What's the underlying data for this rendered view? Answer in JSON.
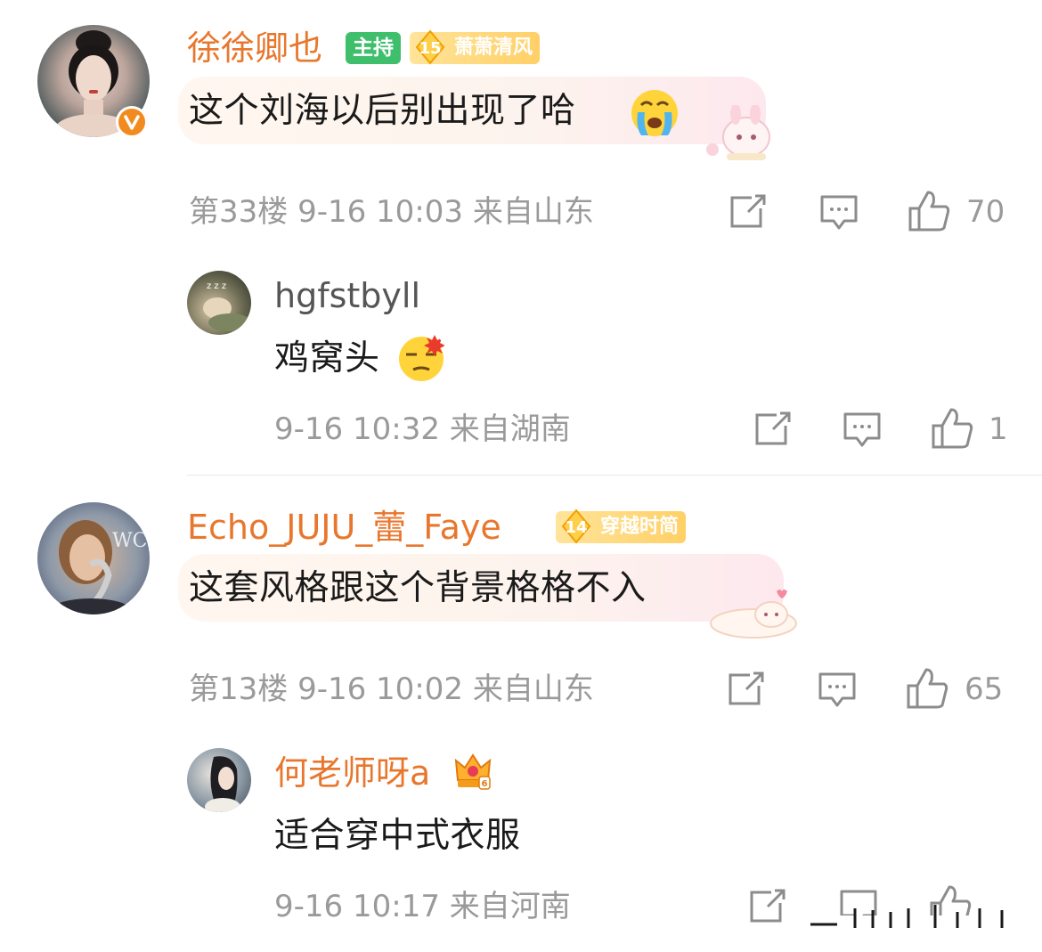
{
  "comments": [
    {
      "user": "徐徐卿也",
      "host_badge": "主持",
      "fan_level": "15",
      "fan_label": "萧萧清风",
      "text": "这个刘海以后别出现了哈",
      "meta": "第33楼 9-16 10:03 来自山东",
      "likes": "70",
      "replies": [
        {
          "user": "hgfstbyll",
          "text": "鸡窝头",
          "meta": "9-16 10:32 来自湖南",
          "likes": "1"
        }
      ]
    },
    {
      "user": "Echo_JUJU_蕾_Faye",
      "fan_level": "14",
      "fan_label": "穿越时简",
      "text": "这套风格跟这个背景格格不入",
      "meta": "第13楼 9-16 10:02 来自山东",
      "likes": "65",
      "replies": [
        {
          "user": "何老师呀a",
          "text": "适合穿中式衣服",
          "meta": "9-16 10:17 来自河南",
          "likes": ""
        }
      ]
    }
  ],
  "colors": {
    "username": "#e8772e",
    "meta": "#9a9a9a",
    "host_badge": "#3fbf6c",
    "verified": "#f28b1f"
  },
  "icons": [
    "verified-icon",
    "forward-icon",
    "comment-icon",
    "like-icon",
    "crying-emoji",
    "annoyed-emoji",
    "crown-icon"
  ]
}
